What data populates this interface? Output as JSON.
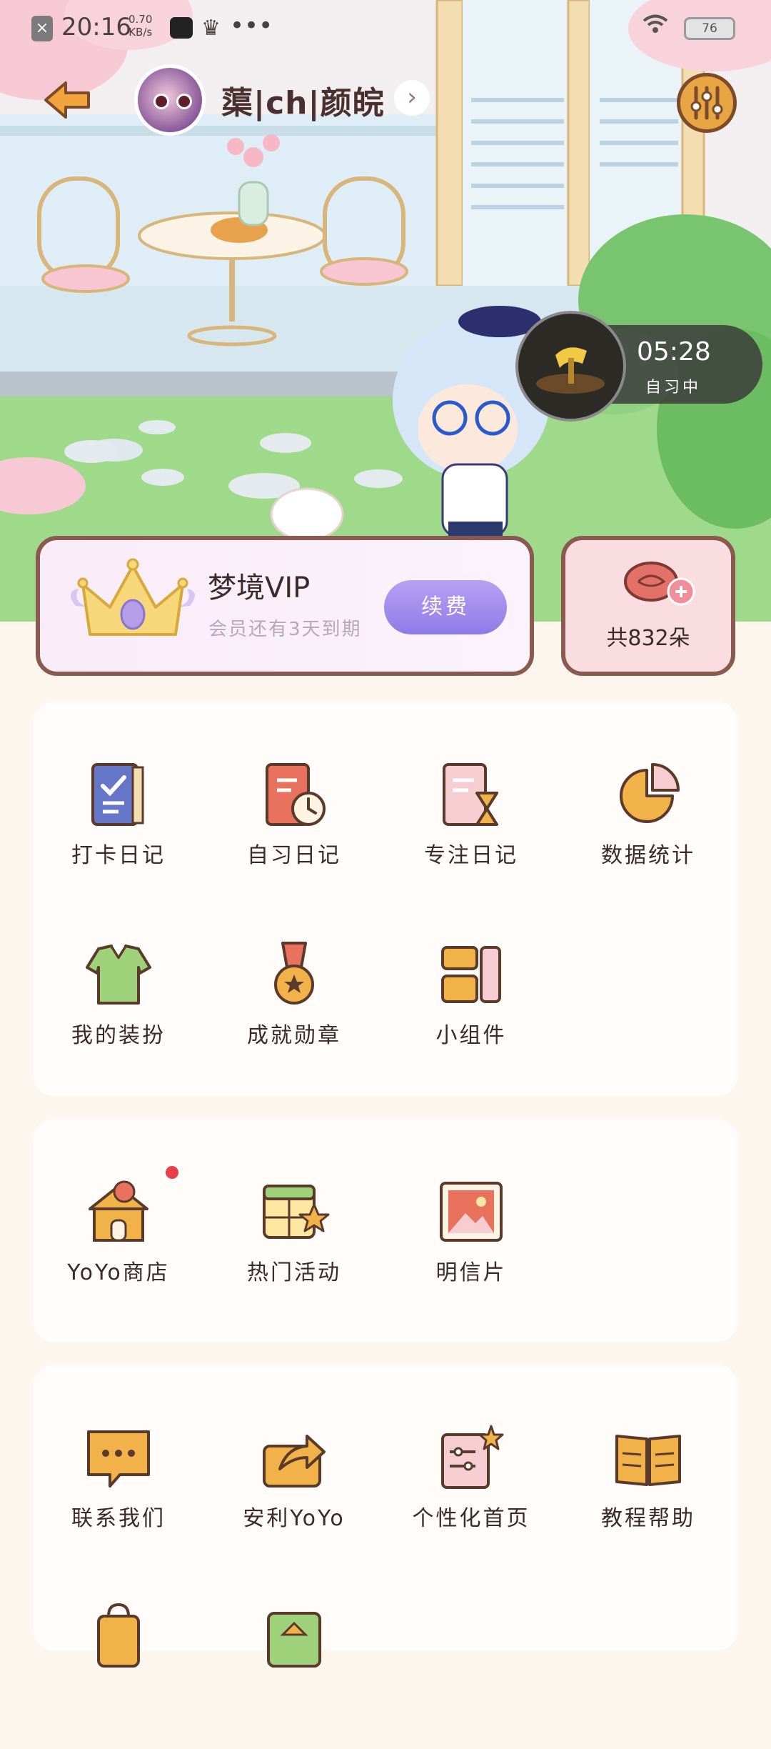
{
  "status_bar": {
    "time": "20:16",
    "speed_value": "0.70",
    "speed_unit": "KB/s",
    "battery": "76"
  },
  "header": {
    "username": "蕖|ch|颜皖"
  },
  "focus_timer": {
    "time": "05:28",
    "status": "自习中"
  },
  "vip": {
    "title": "梦境VIP",
    "subtitle": "会员还有3天到期",
    "button": "续费"
  },
  "flowers": {
    "count_label": "共832朵"
  },
  "sections": [
    {
      "items": [
        {
          "label": "打卡日记",
          "icon": "checklist-book-icon"
        },
        {
          "label": "自习日记",
          "icon": "clock-book-icon"
        },
        {
          "label": "专注日记",
          "icon": "hourglass-book-icon"
        },
        {
          "label": "数据统计",
          "icon": "pie-chart-icon"
        },
        {
          "label": "我的装扮",
          "icon": "sweater-icon"
        },
        {
          "label": "成就勋章",
          "icon": "medal-icon"
        },
        {
          "label": "小组件",
          "icon": "widget-icon"
        }
      ]
    },
    {
      "items": [
        {
          "label": "YoYo商店",
          "icon": "shop-icon"
        },
        {
          "label": "热门活动",
          "icon": "calendar-star-icon"
        },
        {
          "label": "明信片",
          "icon": "postcard-icon"
        }
      ]
    },
    {
      "items": [
        {
          "label": "联系我们",
          "icon": "chat-bubble-icon"
        },
        {
          "label": "安利YoYo",
          "icon": "share-icon"
        },
        {
          "label": "个性化首页",
          "icon": "customize-icon"
        },
        {
          "label": "教程帮助",
          "icon": "open-book-icon"
        }
      ]
    }
  ],
  "colors": {
    "accent": "#8f7ae6",
    "card_border": "#8a5a50",
    "background": "#fdf6ef"
  }
}
